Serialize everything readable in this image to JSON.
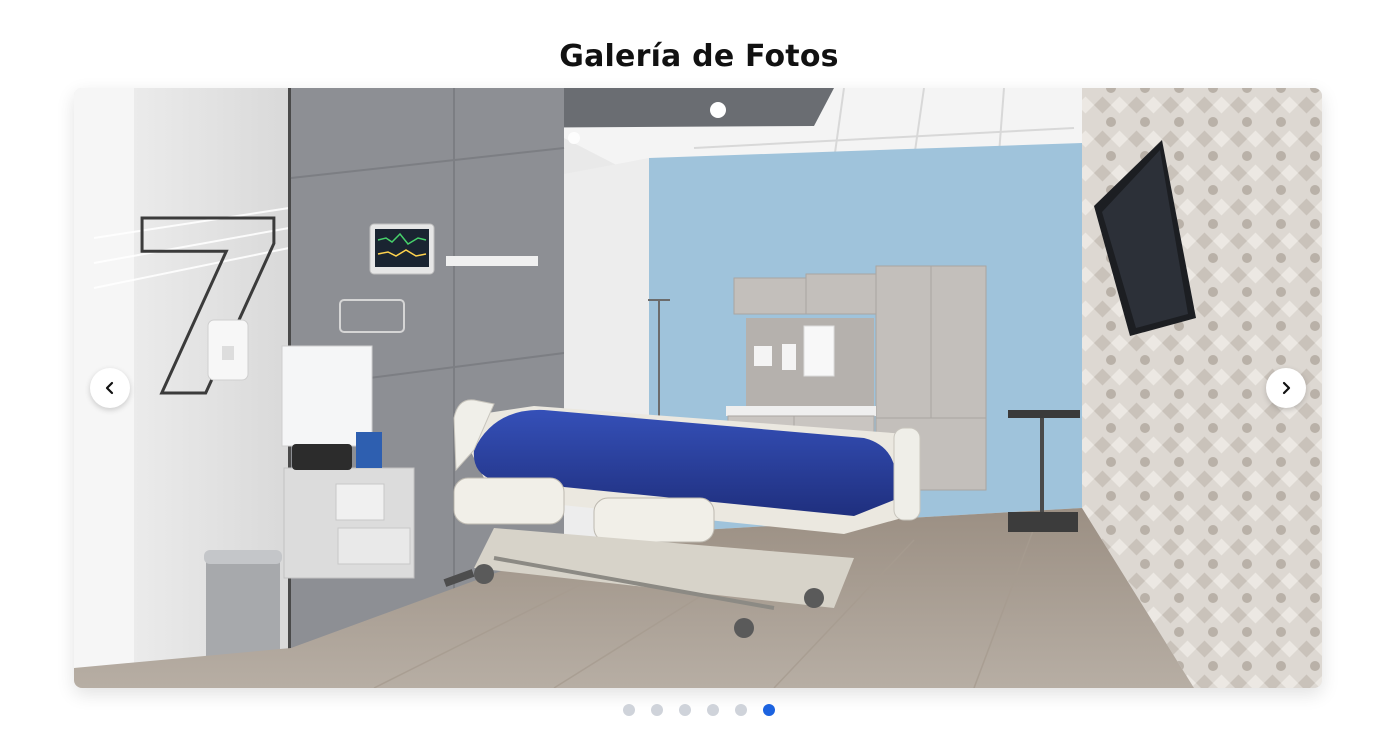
{
  "gallery": {
    "title": "Galería de Fotos",
    "image_alt": "Habitación de hospital con cama, monitor y televisión",
    "room_number": "7",
    "prev_icon": "chevron-left-icon",
    "next_icon": "chevron-right-icon",
    "slide_count": 6,
    "active_slide": 6,
    "dot_color": "#cfd3da",
    "active_dot_color": "#1c63e0",
    "accent_wall_color": "#9fc3db",
    "bed_cover_color": "#2c3f9e"
  }
}
